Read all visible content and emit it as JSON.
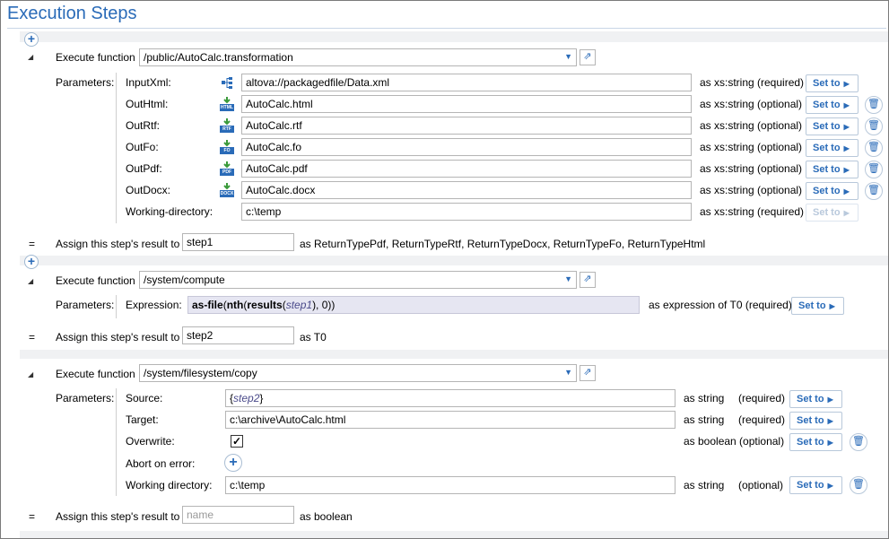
{
  "title": "Execution Steps",
  "colors": {
    "accent": "#2a6bb8",
    "expression_bg": "#e6e6f2"
  },
  "common": {
    "execute_function": "Execute function",
    "parameters": "Parameters:",
    "assign": "Assign this step's result to",
    "set_to": "Set to",
    "eq": "="
  },
  "step1": {
    "function": "/public/AutoCalc.transformation",
    "params": [
      {
        "name": "InputXml:",
        "icon": "xml-tree-icon",
        "value": "altova://packagedfile/Data.xml",
        "type": "as xs:string (required)"
      },
      {
        "name": "OutHtml:",
        "icon": "html-output-icon",
        "value": "AutoCalc.html",
        "type": "as xs:string (optional)"
      },
      {
        "name": "OutRtf:",
        "icon": "rtf-output-icon",
        "value": "AutoCalc.rtf",
        "type": "as xs:string (optional)"
      },
      {
        "name": "OutFo:",
        "icon": "fo-output-icon",
        "value": "AutoCalc.fo",
        "type": "as xs:string (optional)"
      },
      {
        "name": "OutPdf:",
        "icon": "pdf-output-icon",
        "value": "AutoCalc.pdf",
        "type": "as xs:string (optional)"
      },
      {
        "name": "OutDocx:",
        "icon": "docx-output-icon",
        "value": "AutoCalc.docx",
        "type": "as xs:string (optional)"
      },
      {
        "name": "Working-directory:",
        "icon": "",
        "value": "c:\\temp",
        "type": "as xs:string (required)"
      }
    ],
    "icon_labels": [
      "HTML",
      "RTF",
      "FO",
      "PDF",
      "DOCX"
    ],
    "result_name": "step1",
    "result_type": "as ReturnTypePdf, ReturnTypeRtf, ReturnTypeDocx, ReturnTypeFo, ReturnTypeHtml"
  },
  "step2": {
    "function": "/system/compute",
    "param_name": "Expression:",
    "expr": {
      "fn1": "as-file",
      "p1": "(",
      "fn2": "nth",
      "p2": "(",
      "fn3": "results",
      "p3": "(",
      "var": "step1",
      "rest": "), 0))"
    },
    "expr_type": "as expression of T0 (required)",
    "result_name": "step2",
    "result_type": "as T0"
  },
  "step3": {
    "function": "/system/filesystem/copy",
    "source_label": "Source:",
    "source_open": "{",
    "source_var": "step2",
    "source_close": "}",
    "source_type": "as string",
    "source_req": "(required)",
    "target_label": "Target:",
    "target_value": "c:\\archive\\AutoCalc.html",
    "target_type": "as string",
    "target_req": "(required)",
    "overwrite_label": "Overwrite:",
    "overwrite_checked": true,
    "overwrite_type": "as boolean (optional)",
    "abort_label": "Abort on error:",
    "workdir_label": "Working directory:",
    "workdir_value": "c:\\temp",
    "workdir_type": "as string",
    "workdir_req": "(optional)",
    "result_placeholder": "name",
    "result_type": "as boolean"
  }
}
